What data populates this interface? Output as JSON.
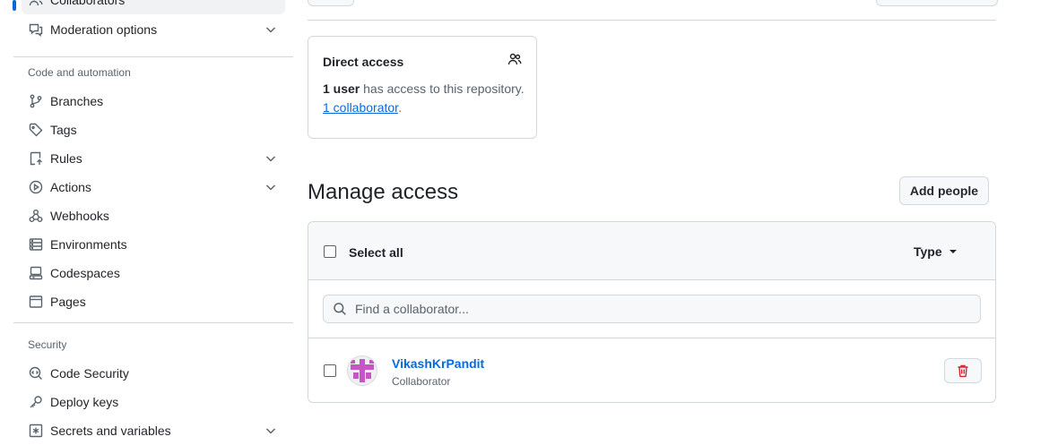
{
  "sidebar": {
    "access_items": [
      {
        "label": "Collaborators",
        "icon": "people-icon",
        "selected": true
      },
      {
        "label": "Moderation options",
        "icon": "report-icon",
        "expandable": true
      }
    ],
    "code_automation_heading": "Code and automation",
    "code_automation_items": [
      {
        "label": "Branches",
        "icon": "git-branch-icon"
      },
      {
        "label": "Tags",
        "icon": "tag-icon"
      },
      {
        "label": "Rules",
        "icon": "repo-push-icon",
        "expandable": true
      },
      {
        "label": "Actions",
        "icon": "play-icon",
        "expandable": true
      },
      {
        "label": "Webhooks",
        "icon": "webhook-icon"
      },
      {
        "label": "Environments",
        "icon": "server-icon"
      },
      {
        "label": "Codespaces",
        "icon": "codespaces-icon"
      },
      {
        "label": "Pages",
        "icon": "browser-icon"
      }
    ],
    "security_heading": "Security",
    "security_items": [
      {
        "label": "Code Security",
        "icon": "codescan-icon"
      },
      {
        "label": "Deploy keys",
        "icon": "key-icon"
      },
      {
        "label": "Secrets and variables",
        "icon": "key-asterisk-icon",
        "expandable": true
      }
    ]
  },
  "direct_access": {
    "title": "Direct access",
    "count_bold": "1 user",
    "count_text": " has access to this repository.",
    "link_text": "1 collaborator",
    "link_suffix": "."
  },
  "manage_access": {
    "title": "Manage access",
    "add_button": "Add people",
    "select_all": "Select all",
    "type_filter": "Type",
    "search_placeholder": "Find a collaborator...",
    "collaborators": [
      {
        "name": "VikashKrPandit",
        "role": "Collaborator"
      }
    ]
  },
  "colors": {
    "accent": "#0969da",
    "danger": "#d1242f",
    "avatar": "#c655c6"
  }
}
